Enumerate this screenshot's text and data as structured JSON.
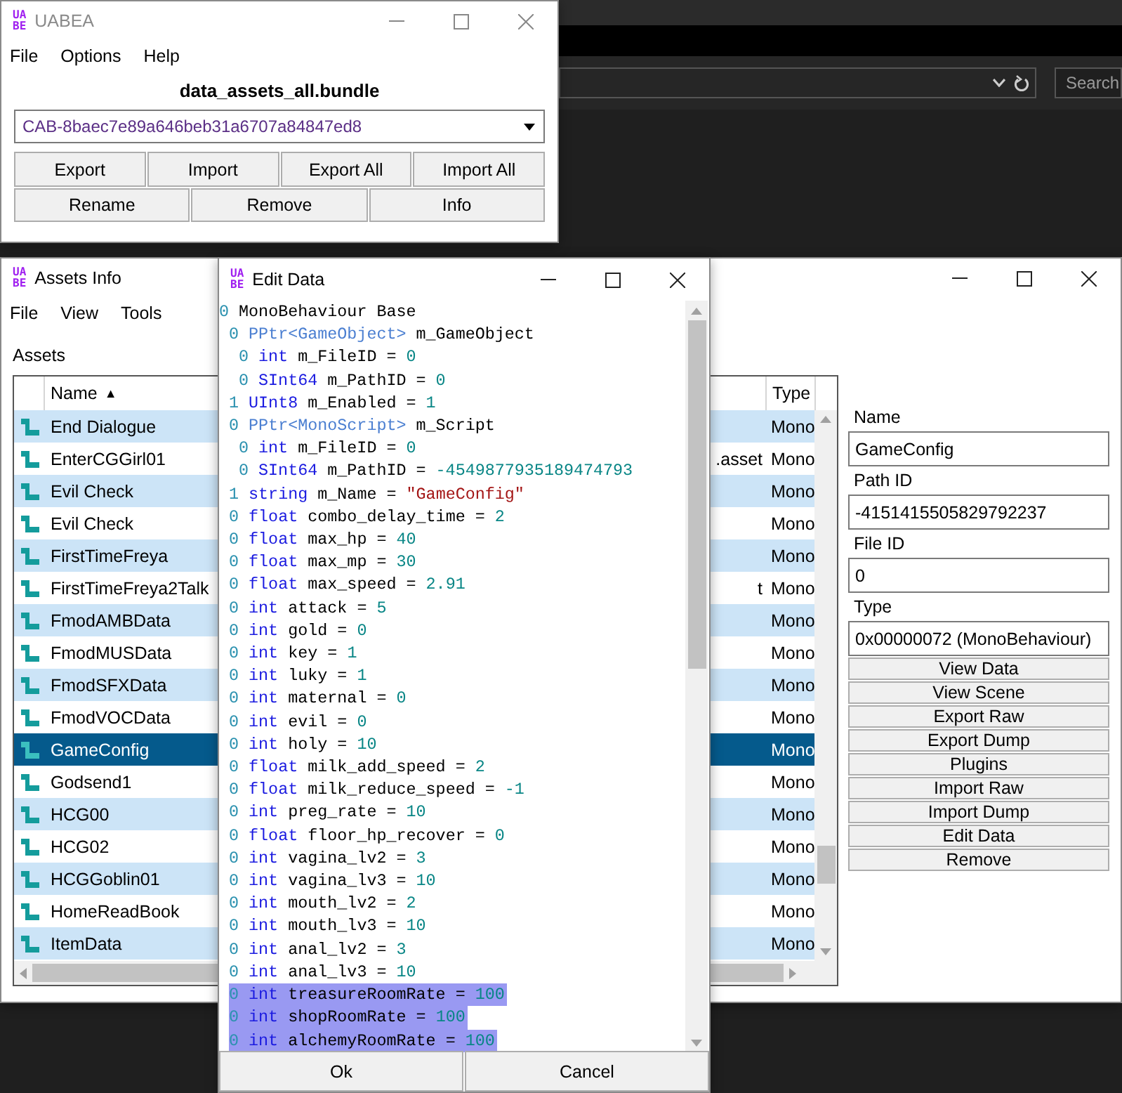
{
  "background_window": {
    "search": {
      "placeholder": "Search"
    }
  },
  "main_window": {
    "logo": [
      "UA",
      "BE"
    ],
    "title": "UABEA",
    "menu": [
      "File",
      "Options",
      "Help"
    ],
    "bundle_name": "data_assets_all.bundle",
    "file_dropdown": {
      "value": "CAB-8baec7e89a646beb31a6707a84847ed8"
    },
    "button_rows": [
      {
        "buttons": [
          "Export",
          "Import",
          "Export All",
          "Import All"
        ]
      },
      {
        "buttons": [
          "Rename",
          "Remove",
          "Info"
        ]
      }
    ]
  },
  "assets_info": {
    "logo": [
      "UA",
      "BE"
    ],
    "title": "Assets Info",
    "menu": [
      "File",
      "View",
      "Tools"
    ],
    "assets_label": "Assets",
    "table": {
      "columns": [
        {
          "label": "Name",
          "sort_glyph": "▲"
        },
        {
          "label": "Type"
        }
      ],
      "rows": [
        {
          "name": "End Dialogue",
          "type": "Mono",
          "selected": false
        },
        {
          "name": "EnterCGGirl01",
          "column_2": ".asset",
          "type": "Mono",
          "selected": false
        },
        {
          "name": "Evil Check",
          "type": "Mono",
          "selected": false
        },
        {
          "name": "Evil Check",
          "type": "Mono",
          "selected": false
        },
        {
          "name": "FirstTimeFreya",
          "type": "Mono",
          "selected": false
        },
        {
          "name": "FirstTimeFreya2Talk",
          "column_2": "t",
          "type": "Mono",
          "selected": false
        },
        {
          "name": "FmodAMBData",
          "type": "Mono",
          "selected": false
        },
        {
          "name": "FmodMUSData",
          "type": "Mono",
          "selected": false
        },
        {
          "name": "FmodSFXData",
          "type": "Mono",
          "selected": false
        },
        {
          "name": "FmodVOCData",
          "type": "Mono",
          "selected": false
        },
        {
          "name": "GameConfig",
          "type": "Mono",
          "selected": true
        },
        {
          "name": "Godsend1",
          "type": "Mono",
          "selected": false
        },
        {
          "name": "HCG00",
          "type": "Mono",
          "selected": false
        },
        {
          "name": "HCG02",
          "type": "Mono",
          "selected": false
        },
        {
          "name": "HCGGoblin01",
          "type": "Mono",
          "selected": false
        },
        {
          "name": "HomeReadBook",
          "type": "Mono",
          "selected": false
        },
        {
          "name": "ItemData",
          "type": "Mono",
          "selected": false
        }
      ]
    },
    "details": {
      "fields": [
        {
          "label": "Name",
          "value": "GameConfig"
        },
        {
          "label": "Path ID",
          "value": "-4151415505829792237"
        },
        {
          "label": "File ID",
          "value": "0"
        },
        {
          "label": "Type",
          "value": "0x00000072 (MonoBehaviour)"
        }
      ],
      "buttons": [
        "View Data",
        "View Scene",
        "Export Raw",
        "Export Dump",
        "Plugins",
        "Import Raw",
        "Import Dump",
        "Edit Data",
        "Remove"
      ]
    }
  },
  "edit_data": {
    "logo": [
      "UA",
      "BE"
    ],
    "title": "Edit Data",
    "lines": [
      {
        "kind": "base",
        "flag": "0",
        "type": "MonoBehaviour",
        "name": "Base",
        "selected": false,
        "children": [
          {
            "kind": "pptr",
            "flag": "0",
            "type": "PPtr<GameObject>",
            "name": "m_GameObject",
            "selected": false,
            "children": [
              {
                "kind": "value",
                "flag": "0",
                "type": "int",
                "name": "m_FileID",
                "equals": "=",
                "value": "0",
                "selected": false
              },
              {
                "kind": "value",
                "flag": "0",
                "type": "SInt64",
                "name": "m_PathID",
                "equals": "=",
                "value": "0",
                "selected": false
              }
            ]
          },
          {
            "kind": "value",
            "flag": "1",
            "type": "UInt8",
            "name": "m_Enabled",
            "equals": "=",
            "value": "1",
            "selected": false
          },
          {
            "kind": "pptr",
            "flag": "0",
            "type": "PPtr<MonoScript>",
            "name": "m_Script",
            "selected": false,
            "children": [
              {
                "kind": "value",
                "flag": "0",
                "type": "int",
                "name": "m_FileID",
                "equals": "=",
                "value": "0",
                "selected": false
              },
              {
                "kind": "value",
                "flag": "0",
                "type": "SInt64",
                "name": "m_PathID",
                "equals": "=",
                "value": "-4549877935189474793",
                "selected": false
              }
            ]
          },
          {
            "kind": "string",
            "flag": "1",
            "type": "string",
            "name": "m_Name",
            "equals": "=",
            "value": "\"GameConfig\"",
            "selected": false
          },
          {
            "kind": "value",
            "flag": "0",
            "type": "float",
            "name": "combo_delay_time",
            "equals": "=",
            "value": "2",
            "selected": false
          },
          {
            "kind": "value",
            "flag": "0",
            "type": "float",
            "name": "max_hp",
            "equals": "=",
            "value": "40",
            "selected": false
          },
          {
            "kind": "value",
            "flag": "0",
            "type": "float",
            "name": "max_mp",
            "equals": "=",
            "value": "30",
            "selected": false
          },
          {
            "kind": "value",
            "flag": "0",
            "type": "float",
            "name": "max_speed",
            "equals": "=",
            "value": "2.91",
            "selected": false
          },
          {
            "kind": "value",
            "flag": "0",
            "type": "int",
            "name": "attack",
            "equals": "=",
            "value": "5",
            "selected": false
          },
          {
            "kind": "value",
            "flag": "0",
            "type": "int",
            "name": "gold",
            "equals": "=",
            "value": "0",
            "selected": false
          },
          {
            "kind": "value",
            "flag": "0",
            "type": "int",
            "name": "key",
            "equals": "=",
            "value": "1",
            "selected": false
          },
          {
            "kind": "value",
            "flag": "0",
            "type": "int",
            "name": "luky",
            "equals": "=",
            "value": "1",
            "selected": false
          },
          {
            "kind": "value",
            "flag": "0",
            "type": "int",
            "name": "maternal",
            "equals": "=",
            "value": "0",
            "selected": false
          },
          {
            "kind": "value",
            "flag": "0",
            "type": "int",
            "name": "evil",
            "equals": "=",
            "value": "0",
            "selected": false
          },
          {
            "kind": "value",
            "flag": "0",
            "type": "int",
            "name": "holy",
            "equals": "=",
            "value": "10",
            "selected": false
          },
          {
            "kind": "value",
            "flag": "0",
            "type": "float",
            "name": "milk_add_speed",
            "equals": "=",
            "value": "2",
            "selected": false
          },
          {
            "kind": "value",
            "flag": "0",
            "type": "float",
            "name": "milk_reduce_speed",
            "equals": "=",
            "value": "-1",
            "selected": false
          },
          {
            "kind": "value",
            "flag": "0",
            "type": "int",
            "name": "preg_rate",
            "equals": "=",
            "value": "10",
            "selected": false
          },
          {
            "kind": "value",
            "flag": "0",
            "type": "float",
            "name": "floor_hp_recover",
            "equals": "=",
            "value": "0",
            "selected": false
          },
          {
            "kind": "value",
            "flag": "0",
            "type": "int",
            "name": "vagina_lv2",
            "equals": "=",
            "value": "3",
            "selected": false
          },
          {
            "kind": "value",
            "flag": "0",
            "type": "int",
            "name": "vagina_lv3",
            "equals": "=",
            "value": "10",
            "selected": false
          },
          {
            "kind": "value",
            "flag": "0",
            "type": "int",
            "name": "mouth_lv2",
            "equals": "=",
            "value": "2",
            "selected": false
          },
          {
            "kind": "value",
            "flag": "0",
            "type": "int",
            "name": "mouth_lv3",
            "equals": "=",
            "value": "10",
            "selected": false
          },
          {
            "kind": "value",
            "flag": "0",
            "type": "int",
            "name": "anal_lv2",
            "equals": "=",
            "value": "3",
            "selected": false
          },
          {
            "kind": "value",
            "flag": "0",
            "type": "int",
            "name": "anal_lv3",
            "equals": "=",
            "value": "10",
            "selected": false
          },
          {
            "kind": "value",
            "flag": "0",
            "type": "int",
            "name": "treasureRoomRate",
            "equals": "=",
            "value": "100",
            "selected": true
          },
          {
            "kind": "value",
            "flag": "0",
            "type": "int",
            "name": "shopRoomRate",
            "equals": "=",
            "value": "100",
            "selected": true
          },
          {
            "kind": "value",
            "flag": "0",
            "type": "int",
            "name": "alchemyRoomRate",
            "equals": "=",
            "value": "100",
            "selected": true
          }
        ]
      }
    ],
    "buttons": [
      "Ok",
      "Cancel"
    ]
  }
}
